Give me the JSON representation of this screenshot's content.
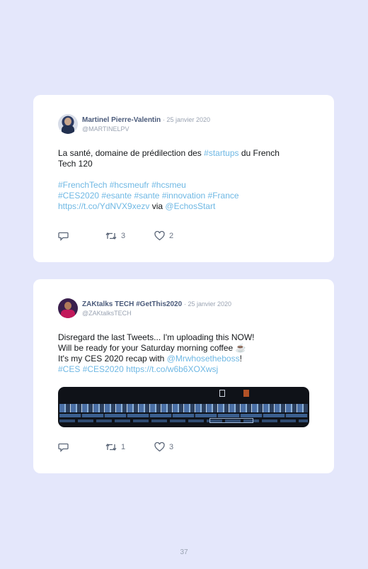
{
  "page_number": "37",
  "tweets": [
    {
      "name": "Martinel Pierre-Valentin",
      "date": "· 25 janvier 2020",
      "handle": "@MARTINELPV",
      "lines": [
        [
          {
            "t": "La santé, domaine de prédilection des ",
            "link": false
          },
          {
            "t": "#startups",
            "link": true
          },
          {
            "t": " du French",
            "link": false
          }
        ],
        [
          {
            "t": "Tech 120",
            "link": false
          }
        ],
        [],
        [
          {
            "t": "#FrenchTech",
            "link": true
          },
          {
            "t": " ",
            "link": false
          },
          {
            "t": "#hcsmeufr",
            "link": true
          },
          {
            "t": " ",
            "link": false
          },
          {
            "t": "#hcsmeu",
            "link": true
          }
        ],
        [
          {
            "t": "#CES2020",
            "link": true
          },
          {
            "t": " ",
            "link": false
          },
          {
            "t": "#esante",
            "link": true
          },
          {
            "t": " ",
            "link": false
          },
          {
            "t": "#sante",
            "link": true
          },
          {
            "t": " ",
            "link": false
          },
          {
            "t": "#innovation",
            "link": true
          },
          {
            "t": " ",
            "link": false
          },
          {
            "t": "#France",
            "link": true
          }
        ],
        [
          {
            "t": "https://t.co/YdNVX9xezv",
            "link": true
          },
          {
            "t": " via ",
            "link": false
          },
          {
            "t": "@EchosStart",
            "link": true
          }
        ]
      ],
      "retweets": "3",
      "likes": "2"
    },
    {
      "name": "ZAKtalks TECH #GetThis2020",
      "date": "· 25 janvier 2020",
      "handle": "@ZAKtalksTECH",
      "lines": [
        [
          {
            "t": "Disregard the last Tweets... I'm uploading this NOW!",
            "link": false
          }
        ],
        [
          {
            "t": "Will be ready for your Saturday morning coffee ☕",
            "link": false
          }
        ],
        [
          {
            "t": "It's my CES 2020 recap with ",
            "link": false
          },
          {
            "t": "@Mrwhosetheboss",
            "link": true
          },
          {
            "t": "!",
            "link": false
          }
        ],
        [
          {
            "t": "#CES",
            "link": true
          },
          {
            "t": " ",
            "link": false
          },
          {
            "t": "#CES2020",
            "link": true
          },
          {
            "t": " ",
            "link": false
          },
          {
            "t": "https://t.co/w6b6XOXwsj",
            "link": true
          }
        ]
      ],
      "retweets": "1",
      "likes": "3"
    }
  ],
  "icons": {
    "reply": "reply-icon",
    "retweet": "retweet-icon",
    "like": "heart-icon"
  },
  "colors": {
    "background": "#e4e7fb",
    "card": "#ffffff",
    "link": "#6fb8e4",
    "name": "#4a5a7a",
    "muted": "#9aa3b2"
  }
}
